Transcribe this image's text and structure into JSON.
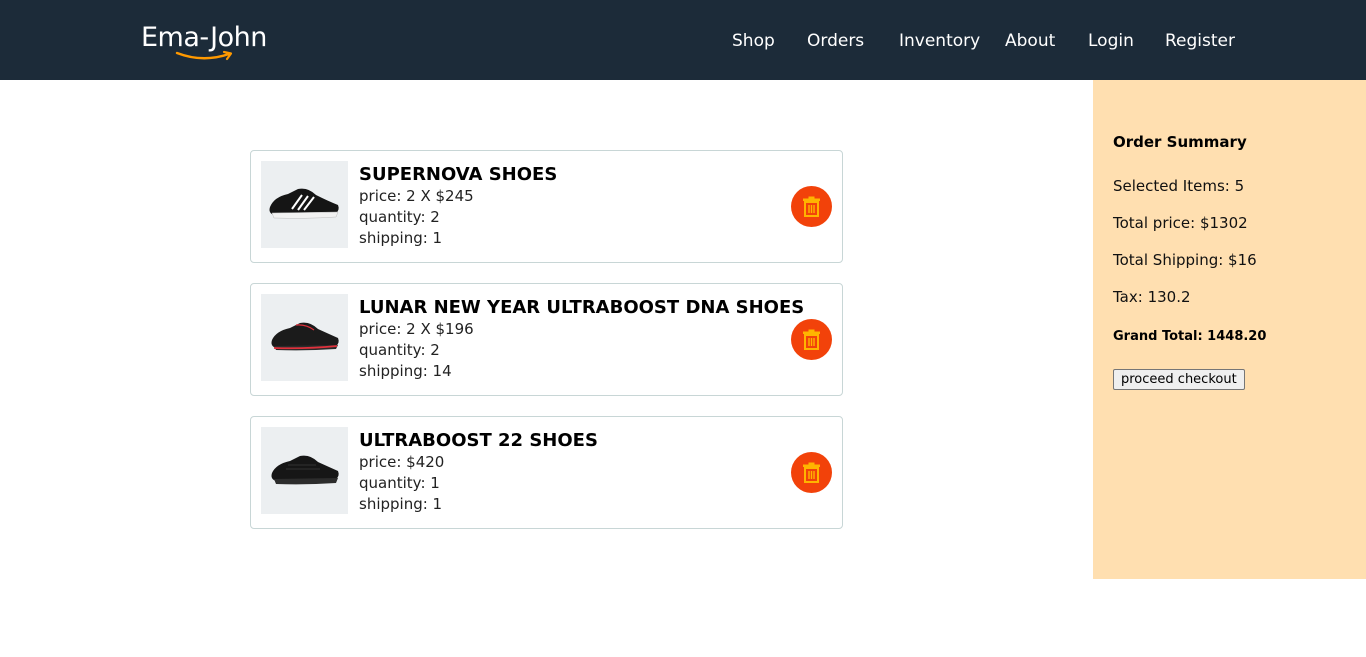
{
  "header": {
    "logo": "Ema-John",
    "nav": [
      "Shop",
      "Orders",
      "Inventory",
      "About",
      "Login",
      "Register"
    ]
  },
  "cart": {
    "items": [
      {
        "name": "SUPERNOVA SHOES",
        "price": "price: 2 X $245",
        "quantity": "quantity: 2",
        "shipping": "shipping: 1",
        "accent": "#ffffff"
      },
      {
        "name": "LUNAR NEW YEAR ULTRABOOST DNA SHOES",
        "price": "price: 2 X $196",
        "quantity": "quantity: 2",
        "shipping": "shipping: 14",
        "accent": "#e0313c"
      },
      {
        "name": "ULTRABOOST 22 SHOES",
        "price": "price: $420",
        "quantity": "quantity: 1",
        "shipping": "shipping: 1",
        "accent": "#2a2a2a"
      }
    ]
  },
  "summary": {
    "title": "Order Summary",
    "selected": "Selected Items: 5",
    "total_price": "Total price: $1302",
    "total_shipping": "Total Shipping: $16",
    "tax": "Tax: 130.2",
    "grand_total": "Grand Total: 1448.20",
    "checkout_label": "proceed checkout"
  },
  "colors": {
    "navbar": "#1c2b39",
    "summary_bg": "#ffdfb0",
    "delete_button": "#f2420a",
    "trash_icon": "#ffb400",
    "logo_smile": "#ff9900"
  },
  "icons": [
    "amazon-smile-icon",
    "trash-icon",
    "shoe-image"
  ]
}
